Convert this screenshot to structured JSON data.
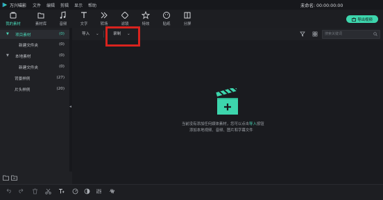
{
  "app": {
    "name": "万兴喵影",
    "timecode": "未命名: 00:00:00:00"
  },
  "menu": [
    "文件",
    "编辑",
    "剪辑",
    "显示",
    "帮助"
  ],
  "toolbar": {
    "tabs": [
      {
        "label": "我的素材",
        "icon": "folder-icon",
        "active": true
      },
      {
        "label": "素材库",
        "icon": "stock-folder-icon"
      },
      {
        "label": "音频",
        "icon": "music-note-icon"
      },
      {
        "label": "文字",
        "icon": "text-icon"
      },
      {
        "label": "转场",
        "icon": "transition-icon"
      },
      {
        "label": "滤镜",
        "icon": "filter-icon"
      },
      {
        "label": "特效",
        "icon": "effects-icon"
      },
      {
        "label": "贴纸",
        "icon": "sticker-icon"
      },
      {
        "label": "分屏",
        "icon": "split-screen-icon"
      }
    ],
    "export_label": "导出视频"
  },
  "sidebar": {
    "items": [
      {
        "label": "项目素材",
        "count": "(0)",
        "selected": true
      },
      {
        "label": "新建文件夹",
        "count": "(0)"
      },
      {
        "label": "本地素材",
        "count": "(0)"
      },
      {
        "label": "新建文件夹",
        "count": "(0)"
      },
      {
        "label": "背景样例",
        "count": "(27)"
      },
      {
        "label": "片头样例",
        "count": "(20)"
      }
    ]
  },
  "filterbar": {
    "import_label": "导入",
    "record_label": "录制",
    "search_placeholder": "搜索关键词"
  },
  "empty_state": {
    "line1_before": "当前没有添加任何媒体素材，您可以点击",
    "line1_link": "导入",
    "line1_after": "按钮",
    "line2": "添加本地视频、音频、图片和字幕文件"
  },
  "colors": {
    "accent": "#3dd6ad",
    "highlight_box": "#d8231e",
    "background": "#1a1b1f"
  }
}
